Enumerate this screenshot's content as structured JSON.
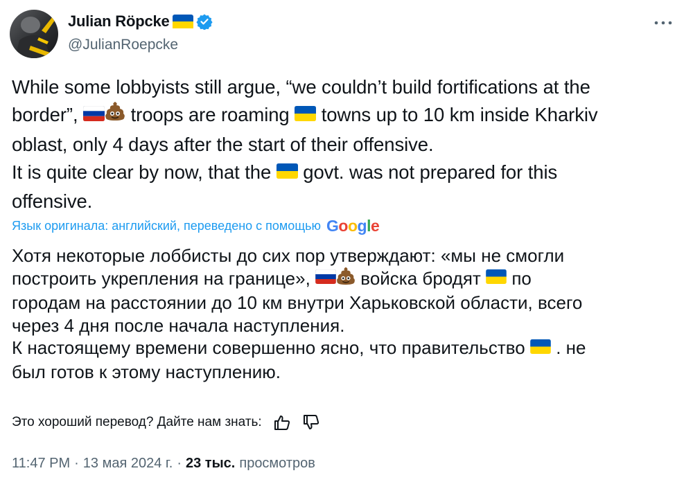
{
  "author": {
    "display_name": "Julian Röpcke",
    "handle": "@JulianRoepcke",
    "name_flag_icon": "ukraine-flag-icon",
    "verified_icon": "verified-badge-icon",
    "verified_color": "#1d9bf0"
  },
  "menu": {
    "icon": "more-options-icon"
  },
  "tweet": {
    "line1": "While some lobbyists still argue, “we couldn’t build fortifications at the",
    "line2_a": "border”,",
    "line2_b": "troops are roaming",
    "line2_c": "towns up to 10 km inside Kharkiv",
    "line3": "oblast, only 4 days after the start of their offensive.",
    "line4_a": "It is quite clear by now, that the",
    "line4_b": "govt. was not prepared for this",
    "line5": "offensive."
  },
  "translation": {
    "label": "Язык оригинала: английский, переведено с помощью",
    "provider": "Google",
    "line1": "Хотя некоторые лоббисты до сих пор утверждают: «мы не смогли",
    "line2_a": "построить укрепления на границе»,",
    "line2_b": "войска бродят",
    "line2_c": "по",
    "line3": "городам на расстоянии до 10 км внутри Харьковской области, всего",
    "line4": "через 4 дня после начала наступления.",
    "line5_a": "К настоящему времени совершенно ясно, что правительство",
    "line5_b": ". не",
    "line6": "был готов к этому наступлению."
  },
  "feedback": {
    "prompt": "Это хороший перевод? Дайте нам знать:",
    "like_icon": "thumbs-up-icon",
    "dislike_icon": "thumbs-down-icon"
  },
  "meta": {
    "time": "11:47 PM",
    "separator": "·",
    "date": "13 мая 2024 г.",
    "views_count": "23 тыс.",
    "views_label": "просмотров"
  },
  "colors": {
    "text": "#0f1419",
    "secondary": "#536471",
    "link": "#1d9bf0",
    "ukraine_blue": "#0057b7",
    "ukraine_yellow": "#ffd700",
    "russia_blue": "#0039a6",
    "russia_red": "#d52b1e",
    "poop": "#8b5a2b"
  }
}
